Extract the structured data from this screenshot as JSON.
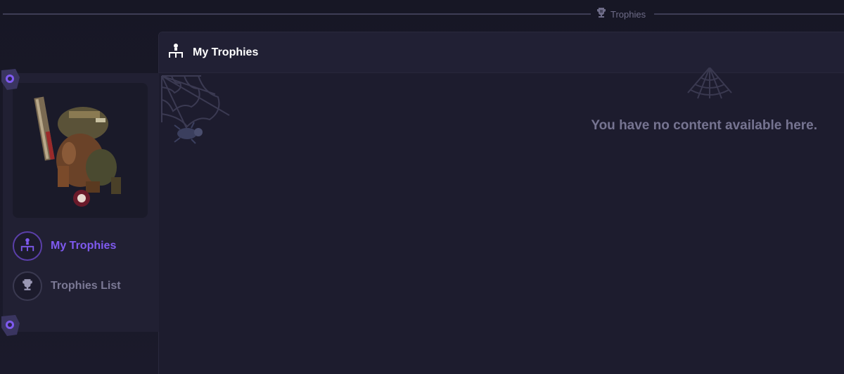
{
  "top_divider": {
    "label": "Trophies",
    "icon": "trophy-icon"
  },
  "panel": {
    "title": "My Trophies",
    "title_icon": "trophy-podium-icon",
    "empty_message": "You have no content available here."
  },
  "sidebar": {
    "avatar_alt": "character-avatar",
    "items": [
      {
        "label": "My Trophies",
        "icon": "trophy-podium-icon",
        "active": true
      },
      {
        "label": "Trophies List",
        "icon": "trophy-icon",
        "active": false
      }
    ]
  },
  "colors": {
    "accent": "#7f5af0",
    "background": "#1a1a2a",
    "panel": "#1d1c2e",
    "muted_text": "#767491"
  }
}
